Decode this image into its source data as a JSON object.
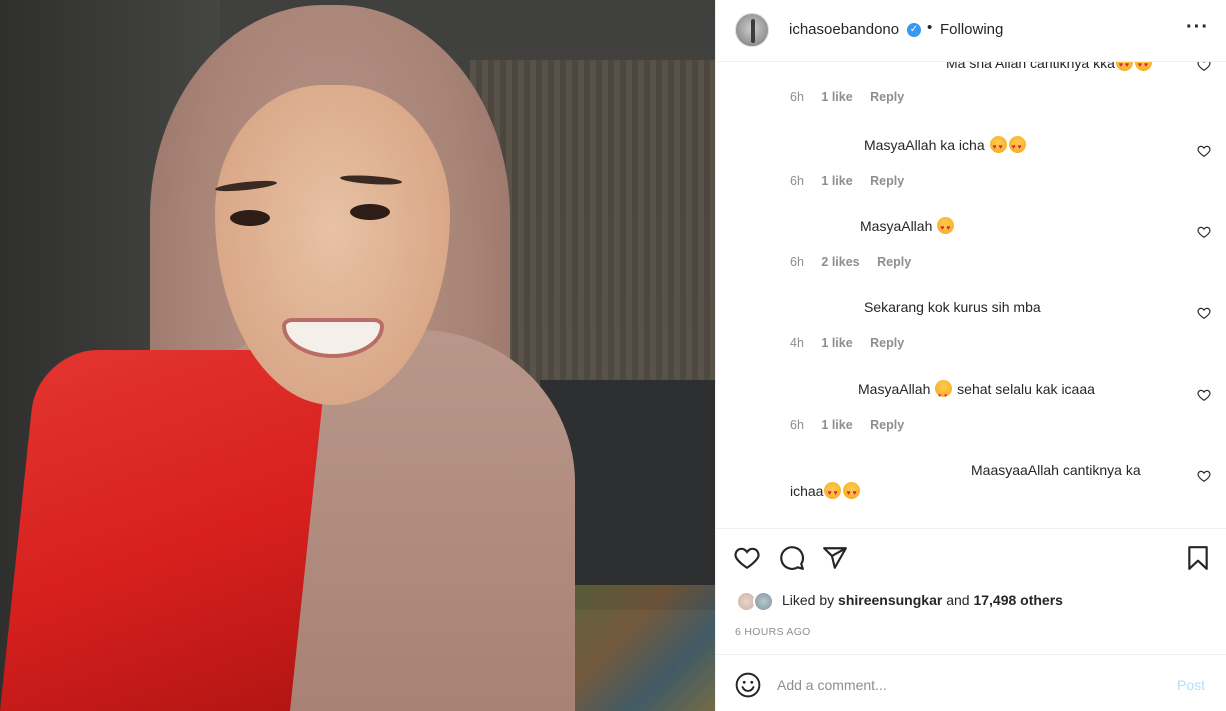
{
  "post": {
    "username": "ichasoebandono",
    "follow_status": "Following",
    "separator": "•",
    "verified_mark": "✓"
  },
  "comments": [
    {
      "text": "Ma sha Allah cantiknya kka",
      "emojis": 2,
      "time": "6h",
      "likes": "1 like",
      "reply": "Reply"
    },
    {
      "text": "MasyaAllah ka icha",
      "emojis": 2,
      "time": "6h",
      "likes": "1 like",
      "reply": "Reply"
    },
    {
      "text": "MasyaAllah",
      "emojis": 1,
      "time": "6h",
      "likes": "2 likes",
      "reply": "Reply"
    },
    {
      "text": "Sekarang kok kurus sih mba",
      "emojis": 0,
      "time": "4h",
      "likes": "1 like",
      "reply": "Reply"
    },
    {
      "text_before": "MasyaAllah",
      "text_after": "sehat selalu kak icaaa",
      "time": "6h",
      "likes": "1 like",
      "reply": "Reply"
    },
    {
      "text_line1": "MaasyaaAllah cantiknya ka",
      "text_line2": "ichaa",
      "emojis": 2
    }
  ],
  "engagement": {
    "liked_by_prefix": "Liked by",
    "liked_by_user": "shireensungkar",
    "liked_by_conj": "and",
    "liked_by_others": "17,498 others",
    "timestamp": "6 HOURS AGO"
  },
  "comment_box": {
    "placeholder": "Add a comment...",
    "post_label": "Post"
  },
  "colors": {
    "verified": "#3897f0",
    "post_disabled": "#b2dffc",
    "meta_gray": "#8e8e8e"
  }
}
